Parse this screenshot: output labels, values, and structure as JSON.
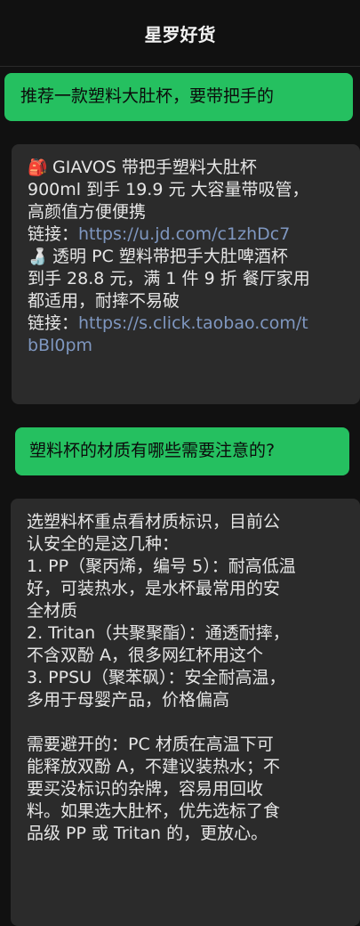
{
  "header": {
    "title": "星罗好货"
  },
  "messages": {
    "q1": "推荐一款塑料大肚杯，要带把手的",
    "a1": {
      "item1": {
        "icon": "backpack-icon",
        "lines": [
          "GIAVOS 带把手塑料大肚杯",
          "900ml 到手 19.9 元 大容量带吸管，",
          "高颜值方便便携"
        ],
        "link_label": "链接：",
        "link_url": "https://u.jd.com/c1zhDc7"
      },
      "item2": {
        "icon": "cup-icon",
        "lines": [
          "透明 PC 塑料带把手大肚啤酒杯",
          "到手 28.8 元，满 1 件 9 折 餐厅家用",
          "都适用，耐摔不易破"
        ],
        "link_label": "链接：",
        "link_url_line1": "https://s.click.taobao.com/t",
        "link_url_line2": "bBl0pm"
      }
    },
    "q2": "塑料杯的材质有哪些需要注意的?",
    "a2": {
      "lines": [
        "选塑料杯重点看材质标识，目前公",
        "认安全的是这几种：",
        "1. PP（聚丙烯，编号 5）：耐高低温",
        "好，可装热水，是水杯最常用的安",
        "全材质",
        "2. Tritan（共聚聚酯）：通透耐摔，",
        "不含双酚 A，很多网红杯用这个",
        "3. PPSU（聚苯砜）：安全耐高温，",
        "多用于母婴产品，价格偏高"
      ],
      "lines2": [
        "需要避开的：PC 材质在高温下可",
        "能释放双酚 A，不建议装热水；不",
        "要买没标识的杂牌，容易用回收",
        "料。如果选大肚杯，优先选标了食",
        "品级 PP 或 Tritan 的，更放心。"
      ]
    }
  }
}
